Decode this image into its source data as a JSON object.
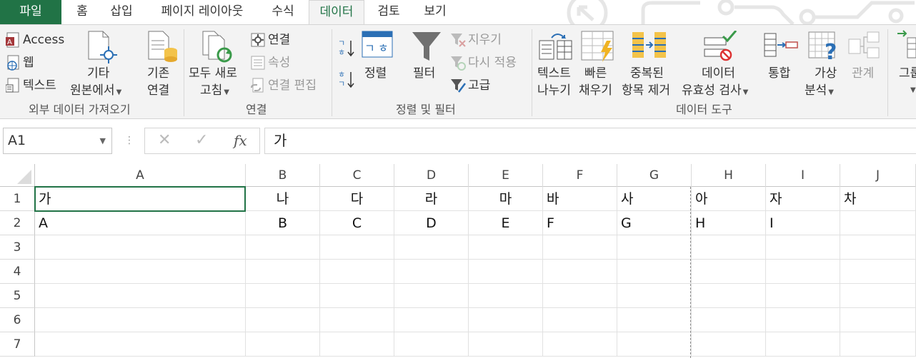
{
  "tabs": [
    "파일",
    "홈",
    "삽입",
    "페이지 레이아웃",
    "수식",
    "데이터",
    "검토",
    "보기"
  ],
  "active_tab": "데이터",
  "ribbon": {
    "groups": [
      "외부 데이터 가져오기",
      "연결",
      "정렬 및 필터",
      "데이터 도구"
    ],
    "external": {
      "access": "Access",
      "web": "웹",
      "text": "텍스트",
      "other_line1": "기타",
      "other_line2": "원본에서",
      "existing_line1": "기존",
      "existing_line2": "연결"
    },
    "connections": {
      "refresh_line1": "모두 새로",
      "refresh_line2": "고침",
      "connections": "연결",
      "properties": "속성",
      "edit_links": "연결 편집"
    },
    "sort_filter": {
      "sort": "정렬",
      "filter": "필터",
      "clear": "지우기",
      "reapply": "다시 적용",
      "advanced": "고급"
    },
    "tools": {
      "text_to_cols_line1": "텍스트",
      "text_to_cols_line2": "나누기",
      "flash_fill_line1": "빠른",
      "flash_fill_line2": "채우기",
      "remove_dup_line1": "중복된",
      "remove_dup_line2": "항목 제거",
      "validation_line1": "데이터",
      "validation_line2": "유효성 검사",
      "consolidate": "통합",
      "whatif_line1": "가상",
      "whatif_line2": "분석",
      "relationships": "관계",
      "group_line1": "그룹"
    }
  },
  "formula_bar": {
    "name_box": "A1",
    "fx": "fx",
    "content": "가"
  },
  "grid": {
    "columns": [
      "A",
      "B",
      "C",
      "D",
      "E",
      "F",
      "G",
      "H",
      "I",
      "J"
    ],
    "rows": [
      "1",
      "2",
      "3",
      "4",
      "5",
      "6",
      "7"
    ],
    "cells": [
      [
        "가",
        "나",
        "다",
        "라",
        "마",
        "바",
        "사",
        "아",
        "자",
        "차"
      ],
      [
        "A",
        "B",
        "C",
        "D",
        "E",
        "F",
        "G",
        "H",
        "I",
        ""
      ]
    ]
  }
}
